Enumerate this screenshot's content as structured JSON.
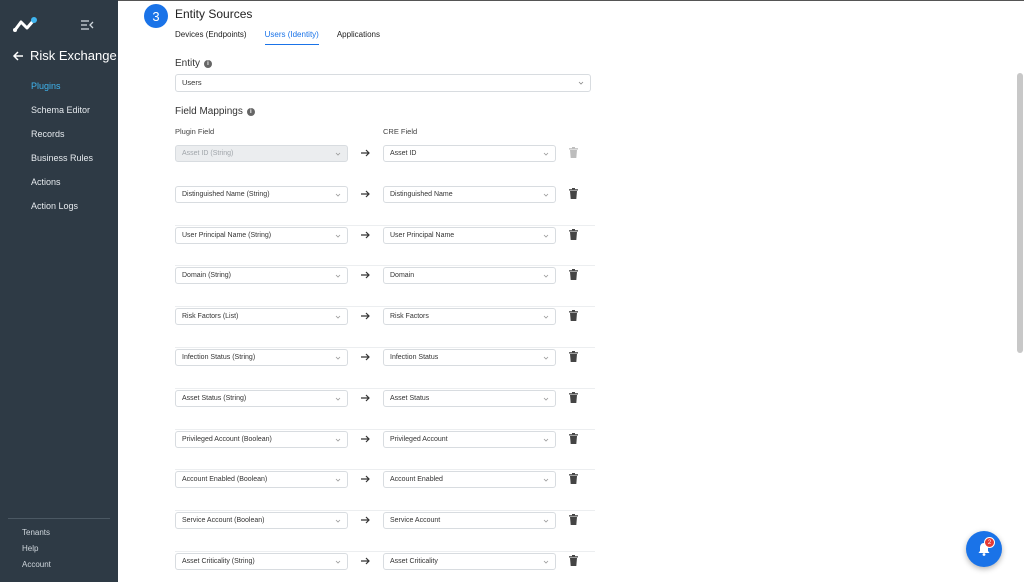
{
  "app": {
    "title": "Risk Exchange"
  },
  "sidebar": {
    "items": [
      {
        "label": "Plugins",
        "active": true
      },
      {
        "label": "Schema Editor"
      },
      {
        "label": "Records"
      },
      {
        "label": "Business Rules"
      },
      {
        "label": "Actions"
      },
      {
        "label": "Action Logs"
      }
    ],
    "footer": [
      {
        "label": "Tenants"
      },
      {
        "label": "Help"
      },
      {
        "label": "Account"
      }
    ]
  },
  "section": {
    "step": "3",
    "title": "Entity Sources",
    "tabs": [
      {
        "label": "Devices (Endpoints)"
      },
      {
        "label": "Users (Identity)",
        "active": true
      },
      {
        "label": "Applications"
      }
    ]
  },
  "entity": {
    "label": "Entity",
    "value": "Users"
  },
  "field_mappings": {
    "label": "Field Mappings",
    "plugin_header": "Plugin Field",
    "cre_header": "CRE Field",
    "rows": [
      {
        "plugin": "Asset ID (String)",
        "cre": "Asset ID",
        "disabled": true
      },
      {
        "plugin": "Distinguished Name (String)",
        "cre": "Distinguished Name"
      },
      {
        "plugin": "User Principal Name (String)",
        "cre": "User Principal Name"
      },
      {
        "plugin": "Domain (String)",
        "cre": "Domain"
      },
      {
        "plugin": "Risk Factors (List)",
        "cre": "Risk Factors"
      },
      {
        "plugin": "Infection Status (String)",
        "cre": "Infection Status"
      },
      {
        "plugin": "Asset Status (String)",
        "cre": "Asset Status"
      },
      {
        "plugin": "Privileged Account (Boolean)",
        "cre": "Privileged Account"
      },
      {
        "plugin": "Account Enabled (Boolean)",
        "cre": "Account Enabled"
      },
      {
        "plugin": "Service Account (Boolean)",
        "cre": "Service Account"
      },
      {
        "plugin": "Asset Criticality (String)",
        "cre": "Asset Criticality"
      }
    ]
  },
  "notifications": {
    "count": "2"
  },
  "colors": {
    "sidebar": "#2e3a45",
    "accent": "#1a73e8",
    "active_nav": "#3fb5f0",
    "badge": "#e53935"
  }
}
